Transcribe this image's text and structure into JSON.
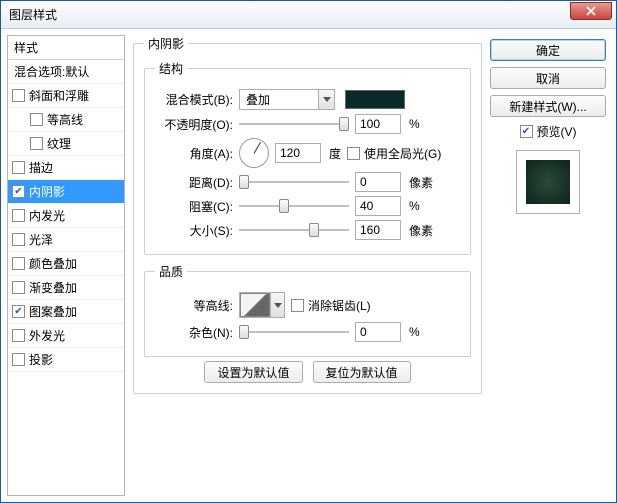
{
  "window": {
    "title": "图层样式"
  },
  "styles": {
    "header": "样式",
    "blend_options": "混合选项:默认",
    "items": [
      {
        "label": "斜面和浮雕",
        "checked": false,
        "indent": false
      },
      {
        "label": "等高线",
        "checked": false,
        "indent": true
      },
      {
        "label": "纹理",
        "checked": false,
        "indent": true
      },
      {
        "label": "描边",
        "checked": false,
        "indent": false
      },
      {
        "label": "内阴影",
        "checked": true,
        "indent": false,
        "selected": true
      },
      {
        "label": "内发光",
        "checked": false,
        "indent": false
      },
      {
        "label": "光泽",
        "checked": false,
        "indent": false
      },
      {
        "label": "颜色叠加",
        "checked": false,
        "indent": false
      },
      {
        "label": "渐变叠加",
        "checked": false,
        "indent": false
      },
      {
        "label": "图案叠加",
        "checked": true,
        "indent": false
      },
      {
        "label": "外发光",
        "checked": false,
        "indent": false
      },
      {
        "label": "投影",
        "checked": false,
        "indent": false
      }
    ]
  },
  "panel": {
    "title": "内阴影",
    "structure": {
      "legend": "结构",
      "blend_mode_label": "混合模式(B):",
      "blend_mode_value": "叠加",
      "color": "#0a2a28",
      "opacity_label": "不透明度(O):",
      "opacity_value": "100",
      "opacity_unit": "%",
      "angle_label": "角度(A):",
      "angle_value": "120",
      "angle_unit": "度",
      "global_light_label": "使用全局光(G)",
      "global_light_checked": false,
      "distance_label": "距离(D):",
      "distance_value": "0",
      "distance_unit": "像素",
      "choke_label": "阻塞(C):",
      "choke_value": "40",
      "choke_unit": "%",
      "size_label": "大小(S):",
      "size_value": "160",
      "size_unit": "像素"
    },
    "quality": {
      "legend": "品质",
      "contour_label": "等高线:",
      "antialias_label": "消除锯齿(L)",
      "antialias_checked": false,
      "noise_label": "杂色(N):",
      "noise_value": "0",
      "noise_unit": "%"
    },
    "buttons": {
      "make_default": "设置为默认值",
      "reset_default": "复位为默认值"
    }
  },
  "right": {
    "ok": "确定",
    "cancel": "取消",
    "new_style": "新建样式(W)...",
    "preview_label": "预览(V)",
    "preview_checked": true
  }
}
